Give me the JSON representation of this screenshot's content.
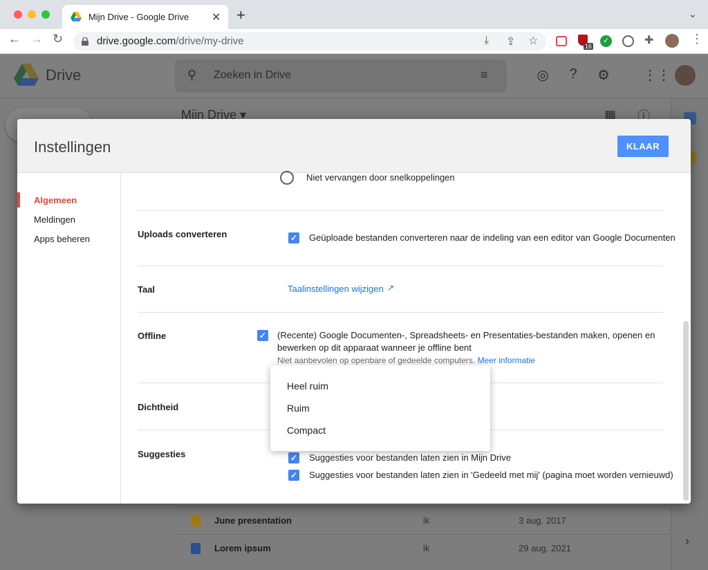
{
  "browser": {
    "tab_title": "Mijn Drive - Google Drive",
    "new_tab": "+",
    "url_host": "drive.google.com",
    "url_path": "/drive/my-drive",
    "extension_badge": "16"
  },
  "drive": {
    "app_name": "Drive",
    "search_placeholder": "Zoeken in Drive",
    "folder_title": "Mijn Drive ▾",
    "files": [
      {
        "name": "June presentation",
        "owner": "ik",
        "date": "3 aug. 2017",
        "icon": "slides-icon",
        "color": "#a07a10"
      },
      {
        "name": "Lorem ipsum",
        "owner": "ik",
        "date": "29 aug. 2021",
        "icon": "docs-icon",
        "color": "#2a4f8f"
      }
    ]
  },
  "settings": {
    "title": "Instellingen",
    "done": "KLAAR",
    "nav": [
      "Algemeen",
      "Meldingen",
      "Apps beheren"
    ],
    "shortcut_option": "Niet vervangen door snelkoppelingen",
    "uploads_label": "Uploads converteren",
    "uploads_text": "Geüploade bestanden converteren naar de indeling van een editor van Google Documenten",
    "language_label": "Taal",
    "language_link": "Taalinstellingen wijzigen",
    "offline_label": "Offline",
    "offline_text": "(Recente) Google Documenten-, Spreadsheets- en Presentaties-bestanden maken, openen en bewerken op dit apparaat wanneer je offline bent",
    "offline_note": "Niet aanbevolen op openbare of gedeelde computers.",
    "offline_more": "Meer informatie",
    "density_label": "Dichtheid",
    "density_options": [
      "Heel ruim",
      "Ruim",
      "Compact"
    ],
    "suggestions_label": "Suggesties",
    "suggestion_1": "Suggesties voor bestanden laten zien in Mijn Drive",
    "suggestion_2": "Suggesties voor bestanden laten zien in 'Gedeeld met mij' (pagina moet worden vernieuwd)"
  },
  "colors": {
    "accent": "#4285f4",
    "active_nav": "#dd4b39",
    "link": "#1a73e8"
  }
}
